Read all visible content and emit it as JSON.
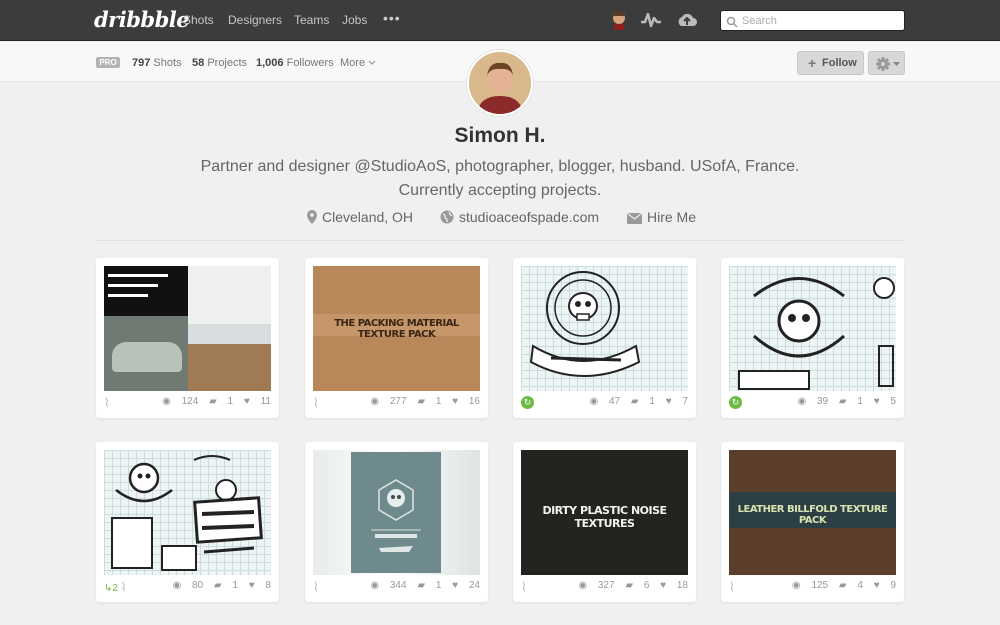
{
  "nav": {
    "logo": "dribbble",
    "items": [
      "Shots",
      "Designers",
      "Teams",
      "Jobs"
    ],
    "more": "•••",
    "search_placeholder": "Search"
  },
  "subbar": {
    "pro_badge": "PRO",
    "shots_count": "797",
    "shots_label": "Shots",
    "projects_count": "58",
    "projects_label": "Projects",
    "followers_count": "1,006",
    "followers_label": "Followers",
    "more_label": "More",
    "follow_label": "Follow"
  },
  "profile": {
    "name": "Simon H.",
    "bio_line1": "Partner and designer @StudioAoS, photographer, blogger, husband. USofA, France.",
    "bio_line2": "Currently accepting projects.",
    "location": "Cleveland, OH",
    "website": "studioaceofspade.com",
    "hire": "Hire Me"
  },
  "shots": [
    {
      "title": "",
      "views": "124",
      "comments": "1",
      "likes": "11",
      "attachment": true,
      "rebound": false,
      "rebound_count": ""
    },
    {
      "title": "THE PACKING MATERIAL TEXTURE PACK",
      "views": "277",
      "comments": "1",
      "likes": "16",
      "attachment": true,
      "rebound": false,
      "rebound_count": ""
    },
    {
      "title": "",
      "views": "47",
      "comments": "1",
      "likes": "7",
      "attachment": false,
      "rebound": true,
      "rebound_count": ""
    },
    {
      "title": "",
      "views": "39",
      "comments": "1",
      "likes": "5",
      "attachment": false,
      "rebound": true,
      "rebound_count": ""
    },
    {
      "title": "",
      "views": "80",
      "comments": "1",
      "likes": "8",
      "attachment": true,
      "rebound": false,
      "rebound_count": "2"
    },
    {
      "title": "",
      "views": "344",
      "comments": "1",
      "likes": "24",
      "attachment": true,
      "rebound": false,
      "rebound_count": ""
    },
    {
      "title": "DIRTY PLASTIC NOISE TEXTURES",
      "views": "327",
      "comments": "6",
      "likes": "18",
      "attachment": true,
      "rebound": false,
      "rebound_count": ""
    },
    {
      "title": "LEATHER BILLFOLD TEXTURE PACK",
      "views": "125",
      "comments": "4",
      "likes": "9",
      "attachment": true,
      "rebound": false,
      "rebound_count": ""
    }
  ],
  "colors": {
    "topbar": "#3c3c3c",
    "background": "#f0f0f0",
    "rebound_green": "#6cba44",
    "cardboard": "#b8875a",
    "dark_texture": "#23241f",
    "leather": "#5b3f2c"
  }
}
